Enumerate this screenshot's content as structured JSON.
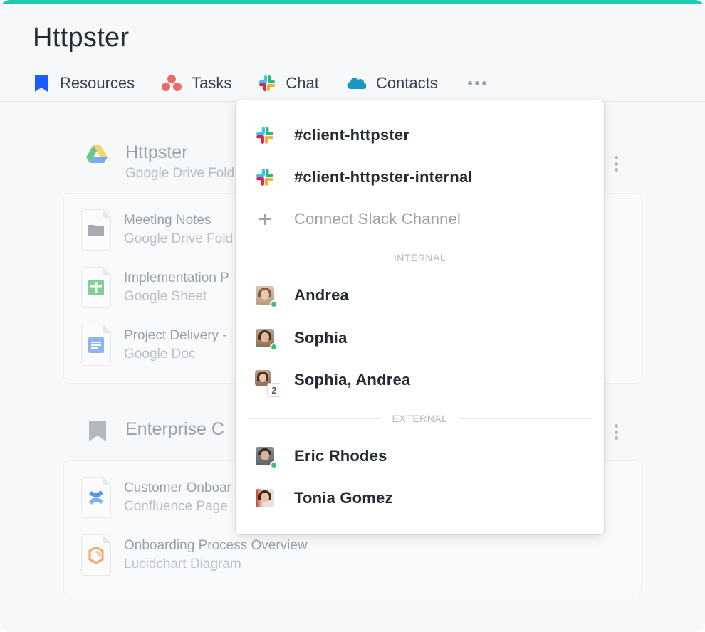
{
  "app": {
    "title": "Httpster",
    "accent_color": "#20c9b0"
  },
  "tabs": [
    {
      "label": "Resources",
      "icon": "bookmark-icon",
      "color": "#1a5cff"
    },
    {
      "label": "Tasks",
      "icon": "asana-icon",
      "color": "#f06a6a"
    },
    {
      "label": "Chat",
      "icon": "slack-icon"
    },
    {
      "label": "Contacts",
      "icon": "salesforce-cloud-icon",
      "color": "#1798c1"
    }
  ],
  "background": {
    "section1": {
      "title": "Httpster",
      "subtitle": "Google Drive Fold",
      "items": [
        {
          "title": "Meeting Notes",
          "subtitle": "Google Drive Fold",
          "icon": "folder-icon"
        },
        {
          "title": "Implementation P",
          "subtitle": "Google Sheet",
          "icon": "sheet-icon"
        },
        {
          "title": "Project Delivery -",
          "subtitle": "Google Doc",
          "icon": "doc-icon"
        }
      ]
    },
    "section2": {
      "title": "Enterprise C",
      "items": [
        {
          "title": "Customer Onboar",
          "subtitle": "Confluence Page",
          "icon": "confluence-icon"
        },
        {
          "title": "Onboarding Process Overview",
          "subtitle": "Lucidchart Diagram",
          "icon": "lucidchart-icon"
        }
      ]
    }
  },
  "dropdown": {
    "channels": [
      {
        "label": "#client-httpster"
      },
      {
        "label": "#client-httpster-internal"
      }
    ],
    "connect_label": "Connect Slack Channel",
    "internal_label": "INTERNAL",
    "internal": [
      {
        "label": "Andrea",
        "online": true
      },
      {
        "label": "Sophia",
        "online": true
      },
      {
        "label": "Sophia, Andrea",
        "count": "2"
      }
    ],
    "external_label": "EXTERNAL",
    "external": [
      {
        "label": "Eric Rhodes",
        "online": true
      },
      {
        "label": "Tonia Gomez"
      }
    ]
  }
}
